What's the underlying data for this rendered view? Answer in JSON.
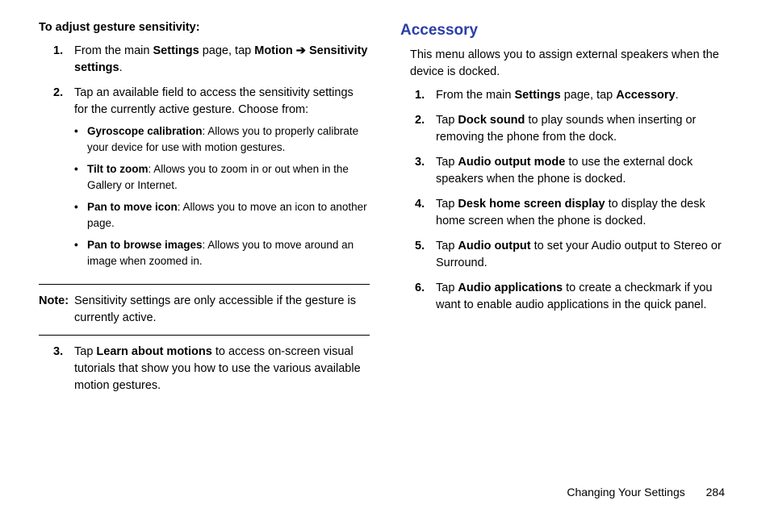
{
  "left": {
    "introTitle": "To adjust gesture sensitivity:",
    "step1_pre": "From the main ",
    "step1_bold1": "Settings",
    "step1_mid": " page, tap ",
    "step1_bold2": "Motion ",
    "step1_arrow": "➔",
    "step1_bold3": " Sensitivity settings",
    "step1_post": ".",
    "step2": "Tap an available field to access the sensitivity settings for the currently active gesture. Choose from:",
    "bullets": {
      "b1_title": "Gyroscope calibration",
      "b1_desc": ": Allows you to properly calibrate your device for use with motion gestures.",
      "b2_title": "Tilt to zoom",
      "b2_desc": ": Allows you to zoom in or out when in the Gallery or Internet.",
      "b3_title": "Pan to move icon",
      "b3_desc": ": Allows you to move an icon to another page.",
      "b4_title": "Pan to browse images",
      "b4_desc": ": Allows you to move around an image when zoomed in."
    },
    "noteLabel": "Note:",
    "noteText": "Sensitivity settings are only accessible if the gesture is currently active.",
    "step3_pre": "Tap ",
    "step3_bold": "Learn about motions",
    "step3_post": " to access on-screen visual tutorials that show you how to use the various available motion gestures."
  },
  "right": {
    "heading": "Accessory",
    "intro": "This menu allows you to assign external speakers when the device is docked.",
    "s1_pre": "From the main ",
    "s1_b1": "Settings",
    "s1_mid": " page, tap ",
    "s1_b2": "Accessory",
    "s1_post": ".",
    "s2_pre": "Tap ",
    "s2_b": "Dock sound",
    "s2_post": " to play sounds when inserting or removing the phone from the dock.",
    "s3_pre": "Tap ",
    "s3_b": "Audio output mode",
    "s3_post": " to use the external dock speakers when the phone is docked.",
    "s4_pre": "Tap ",
    "s4_b": "Desk home screen display",
    "s4_post": " to display the desk home screen when the phone is docked.",
    "s5_pre": "Tap ",
    "s5_b": "Audio output",
    "s5_post": " to set your Audio output to Stereo or Surround.",
    "s6_pre": "Tap ",
    "s6_b": "Audio applications",
    "s6_post": " to create a checkmark if you want to enable audio applications in the quick panel."
  },
  "footer": {
    "chapter": "Changing Your Settings",
    "page": "284"
  },
  "nums": {
    "n1": "1.",
    "n2": "2.",
    "n3": "3.",
    "n4": "4.",
    "n5": "5.",
    "n6": "6."
  },
  "bullet": "•"
}
